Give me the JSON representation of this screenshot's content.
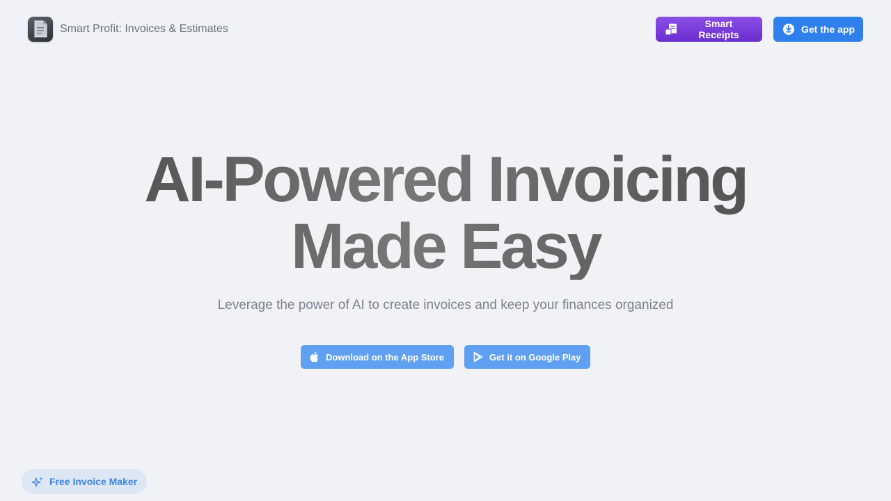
{
  "header": {
    "app_name": "Smart Profit: Invoices & Estimates",
    "app_icon": "document-app-icon",
    "receipts_button_label": "Smart Receipts",
    "receipts_button_icon": "receipt-icon",
    "get_app_button_label": "Get the app",
    "get_app_button_icon": "download-circle-icon"
  },
  "hero": {
    "headline_line1": "AI-Powered Invoicing",
    "headline_line2": "Made Easy",
    "subheadline": "Leverage the power of AI to create invoices and keep your finances organized"
  },
  "store_buttons": {
    "app_store_label": "Download on the App Store",
    "app_store_icon": "apple-icon",
    "google_play_label": "Get it on Google Play",
    "google_play_icon": "google-play-icon"
  },
  "footer": {
    "free_invoice_label": "Free Invoice Maker",
    "free_invoice_icon": "sparkles-icon"
  },
  "colors": {
    "background": "#f0f2f5",
    "receipts_button": "#7a3ddc",
    "get_app_button": "#2f80ed",
    "store_button": "#5fa0f2",
    "pill_background": "#dde7f4",
    "pill_text": "#3e84e0"
  }
}
